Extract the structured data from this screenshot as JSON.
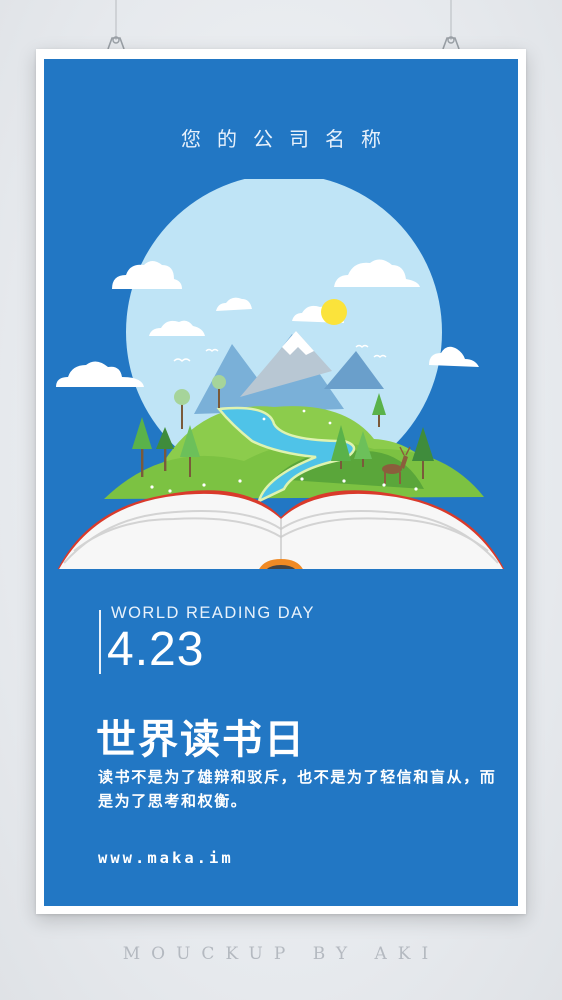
{
  "poster": {
    "company_name": "您的公司名称",
    "event_en": "WORLD READING DAY",
    "date": "4.23",
    "title_cn": "世界读书日",
    "quote_cn": "读书不是为了雄辩和驳斥，也不是为了轻信和盲从，而是为了思考和权衡。",
    "website": "www.maka.im"
  },
  "mockup": {
    "watermark": "MOUCKUP BY AKI"
  },
  "colors": {
    "poster_background": "#2277c4",
    "sky_circle": "#bfe4f6",
    "grass": "#7cc242",
    "river": "#4fc3e8",
    "book_cover_edge": "#d93a2b",
    "bookmark_outer": "#f08a24"
  },
  "icons": {
    "clip": "binder-clip-icon",
    "sun": "sun-icon",
    "deer": "deer-icon",
    "mountain": "mountain-icon",
    "tree": "tree-icon",
    "cloud": "cloud-icon",
    "book": "open-book-icon"
  }
}
